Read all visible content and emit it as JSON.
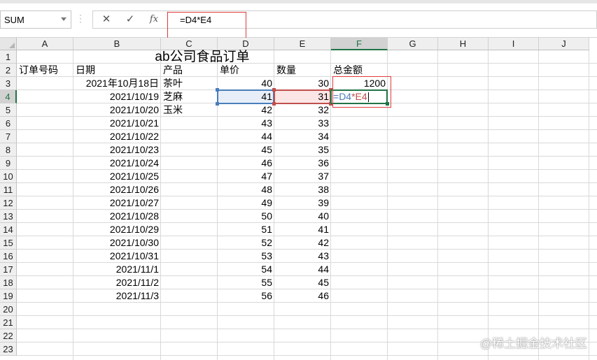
{
  "formula_bar": {
    "name_box": "SUM",
    "cancel_icon": "close-icon",
    "enter_icon": "check-icon",
    "fx_label": "fx",
    "formula": "=D4*E4"
  },
  "columns": [
    "A",
    "B",
    "C",
    "D",
    "E",
    "F",
    "G",
    "H",
    "I",
    "J"
  ],
  "rows": [
    "1",
    "2",
    "3",
    "4",
    "5",
    "6",
    "7",
    "8",
    "9",
    "10",
    "11",
    "12",
    "13",
    "14",
    "15",
    "16",
    "17",
    "18",
    "19",
    "20",
    "21",
    "22",
    "23"
  ],
  "sheet": {
    "title": "ab公司食品订单",
    "headers": {
      "A": "订单号码",
      "B": "日期",
      "C": "产品",
      "D": "单价",
      "E": "数量",
      "F": "总金额"
    },
    "data": [
      {
        "date": "2021年10月18日",
        "product": "茶叶",
        "price": "40",
        "qty": "30",
        "total": "1200"
      },
      {
        "date": "2021/10/19",
        "product": "芝麻",
        "price": "41",
        "qty": "31",
        "total": "=D4*E4"
      },
      {
        "date": "2021/10/20",
        "product": "玉米",
        "price": "42",
        "qty": "32",
        "total": ""
      },
      {
        "date": "2021/10/21",
        "product": "",
        "price": "43",
        "qty": "33",
        "total": ""
      },
      {
        "date": "2021/10/22",
        "product": "",
        "price": "44",
        "qty": "34",
        "total": ""
      },
      {
        "date": "2021/10/23",
        "product": "",
        "price": "45",
        "qty": "35",
        "total": ""
      },
      {
        "date": "2021/10/24",
        "product": "",
        "price": "46",
        "qty": "36",
        "total": ""
      },
      {
        "date": "2021/10/25",
        "product": "",
        "price": "47",
        "qty": "37",
        "total": ""
      },
      {
        "date": "2021/10/26",
        "product": "",
        "price": "48",
        "qty": "38",
        "total": ""
      },
      {
        "date": "2021/10/27",
        "product": "",
        "price": "49",
        "qty": "39",
        "total": ""
      },
      {
        "date": "2021/10/28",
        "product": "",
        "price": "50",
        "qty": "40",
        "total": ""
      },
      {
        "date": "2021/10/29",
        "product": "",
        "price": "51",
        "qty": "41",
        "total": ""
      },
      {
        "date": "2021/10/30",
        "product": "",
        "price": "52",
        "qty": "42",
        "total": ""
      },
      {
        "date": "2021/10/31",
        "product": "",
        "price": "53",
        "qty": "43",
        "total": ""
      },
      {
        "date": "2021/11/1",
        "product": "",
        "price": "54",
        "qty": "44",
        "total": ""
      },
      {
        "date": "2021/11/2",
        "product": "",
        "price": "55",
        "qty": "45",
        "total": ""
      },
      {
        "date": "2021/11/3",
        "product": "",
        "price": "56",
        "qty": "46",
        "total": ""
      }
    ],
    "active_cell": "F4",
    "active_formula_parts": {
      "eq": "=",
      "ref1": "D4",
      "op": "*",
      "ref2": "E4"
    }
  },
  "colors": {
    "accent_green": "#217346",
    "ref_blue": "#4a7ebb",
    "ref_red": "#c0504d",
    "highlight_red": "#e03a3a"
  },
  "watermark": "@稀土掘金技术社区"
}
